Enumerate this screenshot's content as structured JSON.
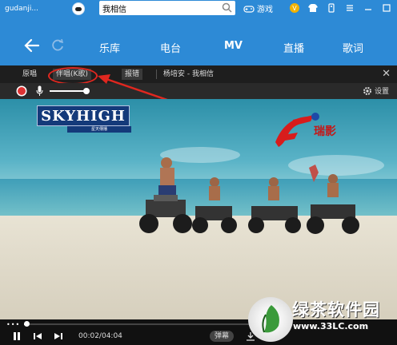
{
  "topbar": {
    "username": "gudanji...",
    "search_value": "我相信",
    "game_label": "游戏"
  },
  "nav": {
    "tabs": [
      "乐库",
      "电台",
      "MV",
      "直播",
      "歌词"
    ],
    "active": "MV"
  },
  "player": {
    "mode_original": "原唱",
    "mode_accompany": "伴唱(K歌)",
    "report_error": "报错",
    "now_playing": "杨培安 - 我相信",
    "settings_label": "设置"
  },
  "video": {
    "logo_text": "SKYHIGH",
    "logo_sub": "星天傳播",
    "brand_text": "瑞影"
  },
  "controls": {
    "time": "00:02/04:04",
    "danmu_label": "弹幕",
    "progress": 0.01
  },
  "watermark": {
    "name": "绿茶软件园",
    "url": "www.33LC.com"
  },
  "colors": {
    "topbar": "#2d8ad6",
    "annotation": "#e0271f"
  }
}
